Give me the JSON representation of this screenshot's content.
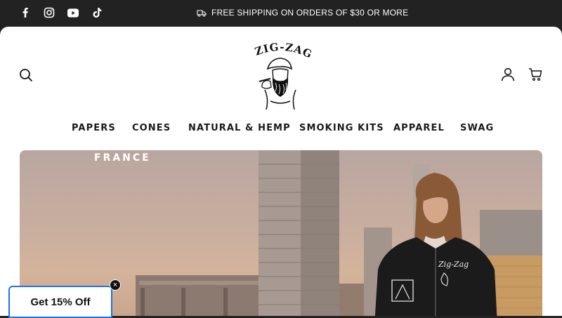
{
  "announcement": {
    "social": [
      {
        "icon": "facebook-icon"
      },
      {
        "icon": "instagram-icon"
      },
      {
        "icon": "youtube-icon"
      },
      {
        "icon": "tiktok-icon"
      }
    ],
    "shipping_text": "FREE SHIPPING ON ORDERS OF $30 OR MORE",
    "shipping_icon": "truck-icon"
  },
  "header": {
    "logo_text": "ZIG-ZAG",
    "search_icon": "search-icon",
    "account_icon": "account-icon",
    "cart_icon": "cart-icon"
  },
  "nav": {
    "items": [
      {
        "label": "PAPERS"
      },
      {
        "label": "CONES"
      },
      {
        "label": "NATURAL & HEMP"
      },
      {
        "label": "SMOKING KITS"
      },
      {
        "label": "APPAREL"
      },
      {
        "label": "SWAG"
      }
    ]
  },
  "hero": {
    "title": "FRANCE",
    "jacket_text": "Zig-Zag"
  },
  "promo": {
    "label": "Get 15% Off",
    "close": "×"
  },
  "colors": {
    "bar_bg": "#222222",
    "promo_border": "#1a73e8"
  }
}
